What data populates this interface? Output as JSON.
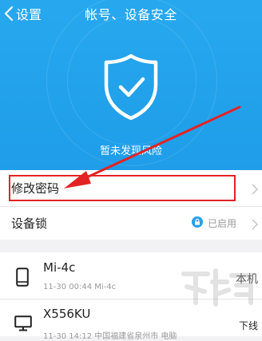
{
  "nav": {
    "back_label": "设置",
    "title": "帐号、设备安全"
  },
  "security": {
    "status": "暂未发现风险"
  },
  "change_password": {
    "label": "修改密码"
  },
  "device_lock": {
    "label": "设备锁",
    "status": "已启用"
  },
  "devices": [
    {
      "name": "Mi-4c",
      "meta": "11-30 00:44 Mi-4c",
      "tag": "本机",
      "icon": "phone-icon"
    },
    {
      "name": "X556KU",
      "meta": "11-30 14:12 中国福建省泉州市 电脑",
      "tag": "下线",
      "icon": "desktop-icon"
    }
  ],
  "watermark": {
    "url": "www.xiazaiba.com"
  },
  "colors": {
    "header_blue": "#24a4ec",
    "highlight_red": "#e32323",
    "lock_blue": "#27a0e8"
  }
}
